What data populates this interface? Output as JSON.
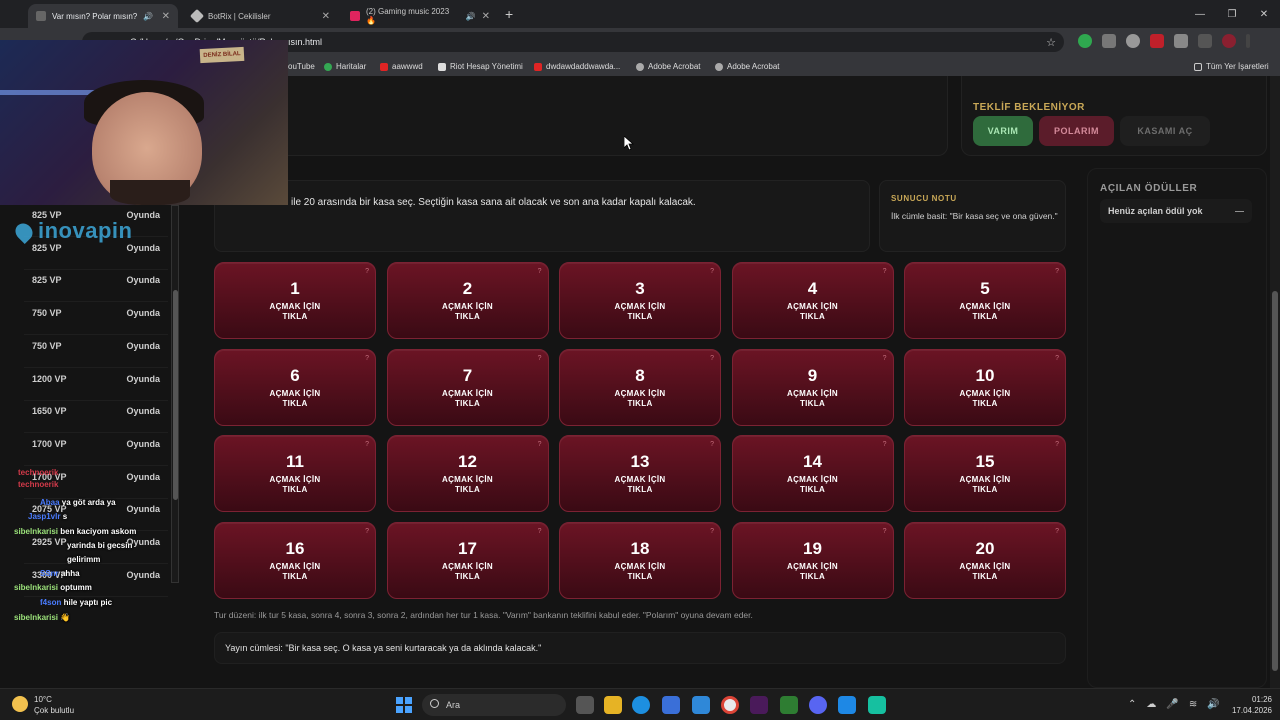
{
  "browser": {
    "tabs": [
      {
        "title": "Var mısın? Polar mısın?",
        "active": true
      },
      {
        "title": "BotRix | Cekilisler",
        "active": false
      },
      {
        "title": "(2) Gaming music 2023 🔥",
        "active": false
      }
    ],
    "address": "C:/Users/.../OneDrive/Masaüstü/Polarmısın.html",
    "bookmarks": [
      "ouTube",
      "Haritalar",
      "aawwwd",
      "Riot Hesap Yönetimi",
      "dwdawdaddwawda...",
      "Adobe Acrobat",
      "Adobe Acrobat"
    ],
    "all_bookmarks": "Tüm Yer İşaretleri"
  },
  "offer": {
    "title": "TEKLİF BEKLENİYOR",
    "yes_label": "VARIM",
    "polar_label": "POLARIM",
    "open_label": "KASAMI AÇ"
  },
  "instructions": "ile 20 arasında bir kasa seç. Seçtiğin kasa sana ait olacak ve son ana kadar kapalı kalacak.",
  "host_note": {
    "title": "SUNUCU NOTU",
    "text": "İlk cümle basit: \"Bir kasa seç ve ona güven.\""
  },
  "rewards": {
    "title": "AÇILAN ÖDÜLLER",
    "empty": "Henüz açılan ödül yok",
    "dash": "—"
  },
  "case_label_line1": "AÇMAK İÇİN",
  "case_label_line2": "TIKLA",
  "cases": [
    "1",
    "2",
    "3",
    "4",
    "5",
    "6",
    "7",
    "8",
    "9",
    "10",
    "11",
    "12",
    "13",
    "14",
    "15",
    "16",
    "17",
    "18",
    "19",
    "20"
  ],
  "rules": "Tur düzeni: ilk tur 5 kasa, sonra 4, sonra 3, sonra 2, ardından her tur 1 kasa. \"Varım\" bankanın teklifini kabul eder. \"Polarım\" oyuna devam eder.",
  "quote": "Yayın cümlesi: \"Bir kasa seç. O kasa ya seni kurtaracak ya da aklında kalacak.\"",
  "overlay": {
    "sign": "DENİZ BİLAL",
    "logo": "inovapin",
    "leaderboard": [
      {
        "vp": "825 VP",
        "status": "Oyunda"
      },
      {
        "vp": "825 VP",
        "status": "Oyunda"
      },
      {
        "vp": "825 VP",
        "status": "Oyunda"
      },
      {
        "vp": "750 VP",
        "status": "Oyunda"
      },
      {
        "vp": "750 VP",
        "status": "Oyunda"
      },
      {
        "vp": "1200 VP",
        "status": "Oyunda"
      },
      {
        "vp": "1650 VP",
        "status": "Oyunda"
      },
      {
        "vp": "1700 VP",
        "status": "Oyunda"
      },
      {
        "vp": "1700 VP",
        "status": "Oyunda"
      },
      {
        "vp": "2075 VP",
        "status": "Oyunda"
      },
      {
        "vp": "2925 VP",
        "status": "Oyunda"
      },
      {
        "vp": "3300 VP",
        "status": "Oyunda"
      }
    ],
    "chat": [
      {
        "user": "technoerik",
        "text": ""
      },
      {
        "user": "technoerik",
        "text": ""
      },
      {
        "user": "Abaa",
        "text": "ya göt arda ya"
      },
      {
        "user": "Jasp1vlr",
        "text": "s"
      },
      {
        "user": "sibelnkarisi",
        "text": "ben kaciyom askom"
      },
      {
        "user": "",
        "text": "yarinda bi gecsin"
      },
      {
        "user": "",
        "text": "gelirimm"
      },
      {
        "user": "SSnr",
        "text": "ahha"
      },
      {
        "user": "sibelnkarisi",
        "text": "optumm"
      },
      {
        "user": "f4son",
        "text": "hile yaptı pic"
      },
      {
        "user": "sibelnkarisi",
        "text": "👋"
      }
    ]
  },
  "taskbar": {
    "temp": "10°C",
    "weather": "Çok bulutlu",
    "search": "Ara",
    "time": "01:26",
    "date": "17.04.2026"
  }
}
